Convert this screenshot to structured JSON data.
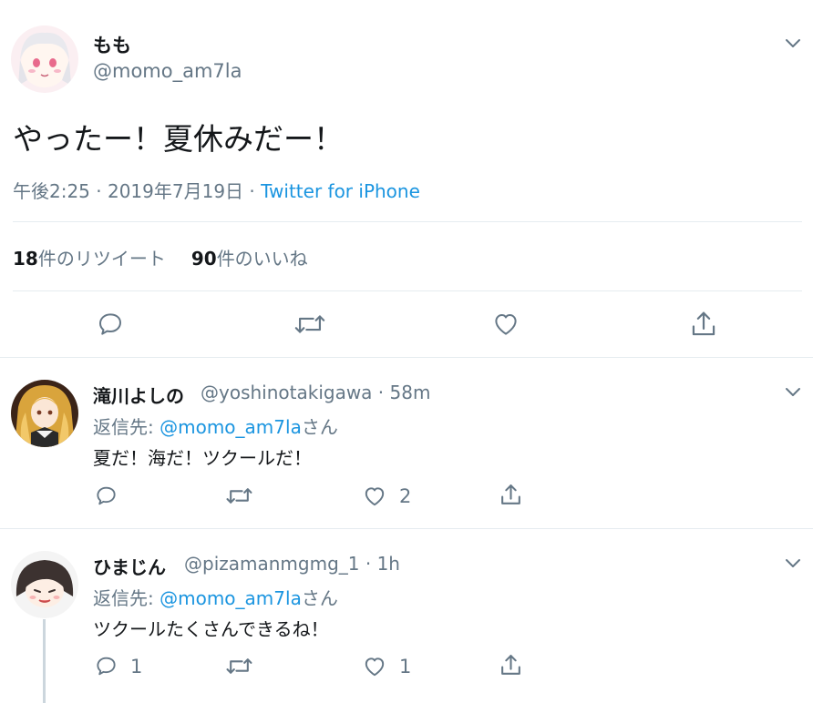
{
  "main_tweet": {
    "display_name": "もも",
    "handle": "@momo_am7la",
    "text": "やったー！夏休みだー！",
    "time": "午後2:25 · 2019年7月19日 · ",
    "source": "Twitter for iPhone",
    "retweets_count": "18",
    "retweets_label": "件のリツイート",
    "likes_count": "90",
    "likes_label": "件のいいね"
  },
  "replies": [
    {
      "display_name": "滝川よしの",
      "handle": "@yoshinotakigawa",
      "time": " · 58m",
      "replying_prefix": "返信先: ",
      "replying_to": "@momo_am7la",
      "replying_suffix": "さん",
      "text": "夏だ！海だ！ツクールだ！",
      "reply_count": "",
      "retweet_count": "",
      "like_count": "2"
    },
    {
      "display_name": "ひまじん",
      "handle": "@pizamanmgmg_1",
      "time": " · 1h",
      "replying_prefix": "返信先: ",
      "replying_to": "@momo_am7la",
      "replying_suffix": "さん",
      "text": "ツクールたくさんできるね！",
      "reply_count": "1",
      "retweet_count": "",
      "like_count": "1"
    }
  ],
  "icons": {
    "menu": "chevron-down-icon",
    "reply": "reply-icon",
    "retweet": "retweet-icon",
    "like": "heart-icon",
    "share": "share-icon"
  },
  "colors": {
    "text": "#14171a",
    "secondary": "#657786",
    "link": "#1b95e0",
    "divider": "#e6ecf0",
    "icon": "#657786"
  }
}
